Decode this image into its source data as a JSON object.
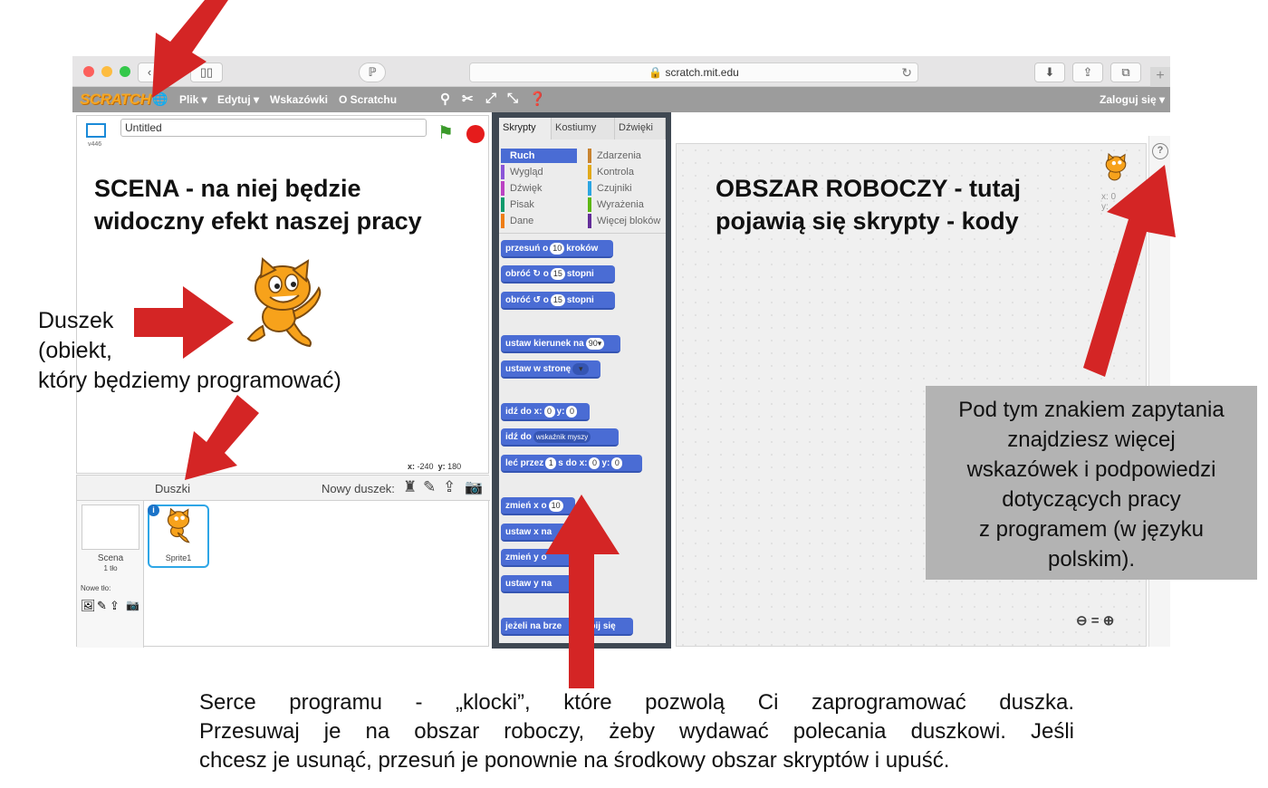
{
  "browser": {
    "url": "scratch.mit.edu",
    "back_icon": "chevron-left-icon",
    "colors": {
      "close": "#fc605c",
      "minimize": "#fdbc40",
      "zoom": "#34c84a"
    }
  },
  "menubar": {
    "logo": "SCRATCH",
    "file": "Plik ▾",
    "edit": "Edytuj ▾",
    "tips": "Wskazówki",
    "about": "O Scratchu",
    "login": "Zaloguj się ▾"
  },
  "stage": {
    "title_value": "Untitled",
    "version": "v446",
    "coords_x_label": "x:",
    "coords_x": "-240",
    "coords_y_label": "y:",
    "coords_y": "180",
    "heading_line1": "SCENA - na niej będzie",
    "heading_line2": "widoczny efekt naszej pracy"
  },
  "sprite_annotation": {
    "line1": "Duszek",
    "line2": "(obiekt,",
    "line3": "który będziemy programować)"
  },
  "sprites": {
    "header": "Duszki",
    "new_sprite": "Nowy duszek:",
    "stage_label": "Scena",
    "stage_sub": "1 tło",
    "new_backdrop": "Nowe tło:",
    "sprite_name": "Sprite1"
  },
  "palette": {
    "tabs": [
      "Skrypty",
      "Kostiumy",
      "Dźwięki"
    ],
    "categories_left": [
      "Ruch",
      "Wygląd",
      "Dźwięk",
      "Pisak",
      "Dane"
    ],
    "categories_right": [
      "Zdarzenia",
      "Kontrola",
      "Czujniki",
      "Wyrażenia",
      "Więcej bloków"
    ],
    "category_colors": {
      "Ruch": "#4a6cd4",
      "Wygląd": "#8a55d7",
      "Dźwięk": "#bb42c3",
      "Pisak": "#0e9a6c",
      "Dane": "#ee7d16",
      "Zdarzenia": "#c88330",
      "Kontrola": "#e1a91a",
      "Czujniki": "#2ca5e2",
      "Wyrażenia": "#5cb712",
      "Więcej bloków": "#632d99"
    },
    "blocks": {
      "move_a": "przesuń o",
      "move_val": "10",
      "move_b": "kroków",
      "turn_r_a": "obróć ↻ o",
      "turn_r_val": "15",
      "turn_r_b": "stopni",
      "turn_l_a": "obróć ↺ o",
      "turn_l_val": "15",
      "turn_l_b": "stopni",
      "point_dir": "ustaw kierunek na",
      "point_dir_val": "90▾",
      "point_towards": "ustaw w stronę",
      "goto_xy_a": "idź do x:",
      "goto_xy_x": "0",
      "goto_xy_b": "y:",
      "goto_xy_y": "0",
      "goto_a": "idź do",
      "goto_val": "wskaźnik myszy",
      "glide_a": "leć przez",
      "glide_t": "1",
      "glide_b": "s do x:",
      "glide_x": "0",
      "glide_c": "y:",
      "glide_y": "0",
      "change_x_a": "zmień x o",
      "change_x_val": "10",
      "set_x": "ustaw x na",
      "change_y": "zmień y o",
      "set_y": "ustaw y na",
      "bounce_a": "jeżeli na brze",
      "bounce_b": "dbij się"
    }
  },
  "script_area": {
    "heading_line1": "OBSZAR ROBOCZY - tutaj",
    "heading_line2": "pojawią się skrypty - kody",
    "sprite_x": "x: 0",
    "sprite_y": "y:",
    "help": "?",
    "zoom_out": "🔍−",
    "zoom_reset": "=",
    "zoom_in": "🔍+"
  },
  "help_note": {
    "lines": [
      "Pod tym znakiem zapytania",
      "znajdziesz więcej",
      "wskazówek i podpowiedzi",
      "dotyczących pracy",
      "z programem (w języku",
      "polskim)."
    ]
  },
  "bottom_note": {
    "line1": "Serce programu - „klocki”, które pozwolą Ci zaprogramować duszka.",
    "line2": "Przesuwaj je na obszar roboczy, żeby wydawać polecania duszkowi. Jeśli",
    "line3": "chcesz je usunąć, przesuń je ponownie na środkowy obszar skryptów i upuść."
  },
  "arrow_color": "#d42525"
}
